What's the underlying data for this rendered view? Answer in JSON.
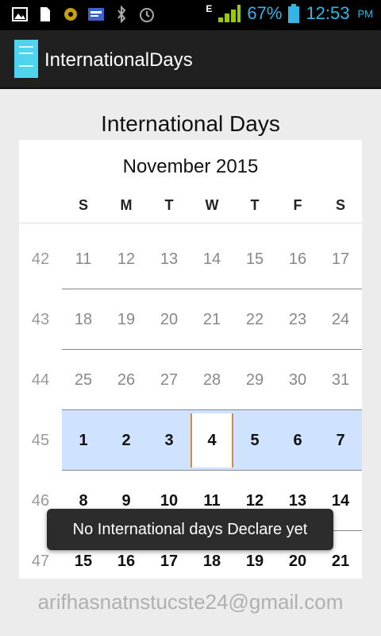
{
  "status_bar": {
    "battery": "67%",
    "time": "12:53",
    "ampm": "PM",
    "network": "E"
  },
  "app": {
    "title": "InternationalDays"
  },
  "page": {
    "heading": "International Days"
  },
  "calendar": {
    "month": "November 2015",
    "weekdays": [
      "S",
      "M",
      "T",
      "W",
      "T",
      "F",
      "S"
    ],
    "weeks": [
      {
        "num": "42",
        "days": [
          "11",
          "12",
          "13",
          "14",
          "15",
          "16",
          "17"
        ]
      },
      {
        "num": "43",
        "days": [
          "18",
          "19",
          "20",
          "21",
          "22",
          "23",
          "24"
        ]
      },
      {
        "num": "44",
        "days": [
          "25",
          "26",
          "27",
          "28",
          "29",
          "30",
          "31"
        ]
      },
      {
        "num": "45",
        "days": [
          "1",
          "2",
          "3",
          "4",
          "5",
          "6",
          "7"
        ]
      },
      {
        "num": "46",
        "days": [
          "8",
          "9",
          "10",
          "11",
          "12",
          "13",
          "14"
        ]
      },
      {
        "num": "47",
        "days": [
          "15",
          "16",
          "17",
          "18",
          "19",
          "20",
          "21"
        ]
      }
    ],
    "selected_day": "4"
  },
  "toast": {
    "message": "No International days Declare yet"
  },
  "footer": {
    "email": "arifhasnatnstucste24@gmail.com"
  }
}
